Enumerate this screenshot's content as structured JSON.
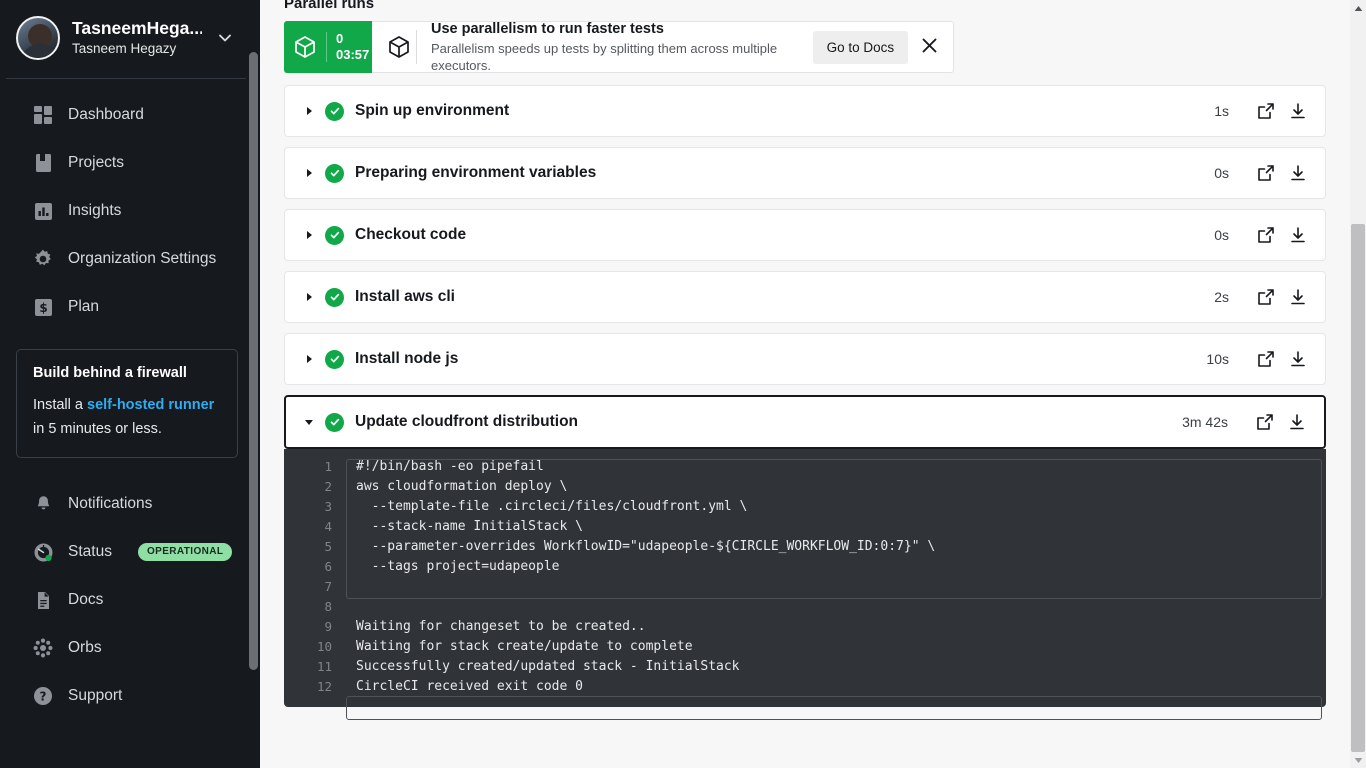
{
  "sidebar": {
    "org": {
      "name": "TasneemHega...",
      "user": "Tasneem Hegazy",
      "avatar_alt": "user-avatar",
      "chevron": "chevron-down-icon"
    },
    "nav": [
      {
        "label": "Dashboard",
        "icon": "dashboard-icon"
      },
      {
        "label": "Projects",
        "icon": "projects-icon"
      },
      {
        "label": "Insights",
        "icon": "insights-icon"
      },
      {
        "label": "Organization Settings",
        "icon": "gear-icon"
      },
      {
        "label": "Plan",
        "icon": "dollar-icon"
      }
    ],
    "promo": {
      "title": "Build behind a firewall",
      "text_before": "Install a ",
      "link": "self-hosted runner",
      "text_after": " in 5 minutes or less."
    },
    "bottom_nav": [
      {
        "label": "Notifications",
        "icon": "bell-icon",
        "badge": null
      },
      {
        "label": "Status",
        "icon": "gauge-icon",
        "badge": "OPERATIONAL"
      },
      {
        "label": "Docs",
        "icon": "document-icon",
        "badge": null
      },
      {
        "label": "Orbs",
        "icon": "orbs-icon",
        "badge": null
      },
      {
        "label": "Support",
        "icon": "question-circle-icon",
        "badge": null
      }
    ]
  },
  "main": {
    "section_title": "Parallel runs",
    "parallel_chip": {
      "index": "0",
      "duration": "03:57",
      "icon": "cube-icon",
      "color": "#11a84a"
    },
    "banner": {
      "icon": "cube-icon",
      "heading": "Use parallelism to run faster tests",
      "subtext": "Parallelism speeds up tests by splitting them across multiple executors.",
      "button": "Go to Docs",
      "close_icon": "close-icon"
    },
    "steps": [
      {
        "name": "Spin up environment",
        "duration": "1s",
        "status": "success",
        "expanded": false,
        "focused": false
      },
      {
        "name": "Preparing environment variables",
        "duration": "0s",
        "status": "success",
        "expanded": false,
        "focused": false
      },
      {
        "name": "Checkout code",
        "duration": "0s",
        "status": "success",
        "expanded": false,
        "focused": false
      },
      {
        "name": "Install aws cli",
        "duration": "2s",
        "status": "success",
        "expanded": false,
        "focused": false
      },
      {
        "name": "Install node js",
        "duration": "10s",
        "status": "success",
        "expanded": false,
        "focused": false
      },
      {
        "name": "Update cloudfront distribution",
        "duration": "3m 42s",
        "status": "success",
        "expanded": true,
        "focused": true
      }
    ],
    "step_actions": {
      "open_icon": "external-link-icon",
      "download_icon": "download-icon"
    },
    "log": {
      "lines": [
        {
          "n": "1",
          "text": "#!/bin/bash -eo pipefail"
        },
        {
          "n": "2",
          "text": "aws cloudformation deploy \\"
        },
        {
          "n": "3",
          "text": "  --template-file .circleci/files/cloudfront.yml \\"
        },
        {
          "n": "4",
          "text": "  --stack-name InitialStack \\"
        },
        {
          "n": "5",
          "text": "  --parameter-overrides WorkflowID=\"udapeople-${CIRCLE_WORKFLOW_ID:0:7}\" \\"
        },
        {
          "n": "6",
          "text": "  --tags project=udapeople"
        },
        {
          "n": "7",
          "text": ""
        },
        {
          "n": "",
          "text": ""
        },
        {
          "n": "8",
          "text": ""
        },
        {
          "n": "9",
          "text": "Waiting for changeset to be created.."
        },
        {
          "n": "10",
          "text": "Waiting for stack create/update to complete"
        },
        {
          "n": "11",
          "text": "Successfully created/updated stack - InitialStack"
        },
        {
          "n": "12",
          "text": "CircleCI received exit code 0"
        }
      ]
    }
  },
  "scrollbars": {
    "main_vertical": "main-scrollbar",
    "sidebar_vertical": "sidebar-scrollbar"
  }
}
